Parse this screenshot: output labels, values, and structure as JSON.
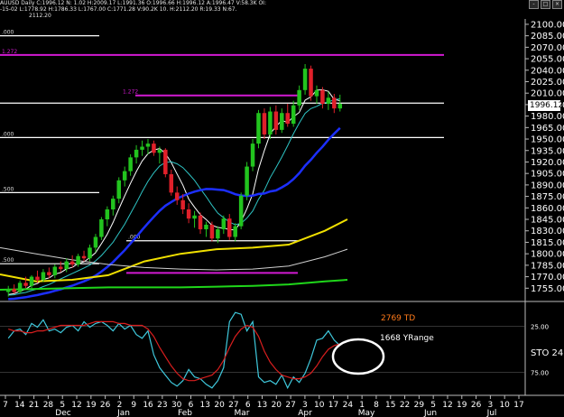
{
  "header": {
    "line1": "AUUSD Daily C:1996.12 N: 1.02 H:2009.17 L:1991.36 O:1996.66 H:1996.12 A:1996.47 V:58.3K OI:",
    "line2": "-15-02 L:1778.92 H:1786.33 L:1767.00 C:1771.28 V:90.2K 10. H:2112.20 R:19.33 N:67.",
    "line3": "2112.20",
    "window_buttons": [
      "-",
      "□",
      "×"
    ]
  },
  "colors": {
    "background": "#000000",
    "candle_up": "#22c41e",
    "candle_down": "#e0202a",
    "ma_fast": "#ffffff",
    "ma_mid": "#2ec4c4",
    "ma_blue": "#1c2fff",
    "ma_yellow": "#f0e000",
    "ma_green": "#1fd61a",
    "ma_white_slow": "#cfcfcf",
    "fib_magenta": "#d21ad2",
    "stoch_fast": "#3fc8dc",
    "stoch_slow": "#d81e1e",
    "annotation_orange": "#ff7a1a"
  },
  "chart_data": [
    {
      "type": "candlestick",
      "title": "AU/USD Daily",
      "ylim": [
        1740,
        2107
      ],
      "y_ticks": [
        "2100.00",
        "2085.00",
        "2070.00",
        "2055.00",
        "2040.00",
        "2025.00",
        "2010.00",
        "1995.00",
        "1980.00",
        "1965.00",
        "1950.00",
        "1935.00",
        "1920.00",
        "1905.00",
        "1890.00",
        "1875.00",
        "1860.00",
        "1845.00",
        "1830.00",
        "1815.00",
        "1800.00",
        "1785.00",
        "1770.00",
        "1755.00"
      ],
      "last_price_label": "1996.12",
      "x_tick_labels": [
        "7",
        "14",
        "21",
        "28",
        "5",
        "12",
        "19",
        "26",
        "2",
        "9",
        "16",
        "23",
        "30",
        "6",
        "13",
        "20",
        "27",
        "6",
        "13",
        "20",
        "27",
        "3",
        "10",
        "17",
        "24",
        "1",
        "8",
        "15",
        "22",
        "29",
        "5",
        "12",
        "19",
        "26",
        "3",
        "10",
        "17"
      ],
      "month_labels": [
        "Dec",
        "Jan",
        "Feb",
        "Mar",
        "Apr",
        "May",
        "Jun",
        "Jul"
      ],
      "horizontal_levels": [
        {
          "label": "1.272",
          "price": 2060,
          "color": "magenta",
          "span": "full"
        },
        {
          "label": "1.272",
          "price": 2007,
          "color": "magenta",
          "span": "right"
        },
        {
          "label": "",
          "price": 1997,
          "color": "white",
          "span": "full"
        },
        {
          "label": ".000",
          "price": 1952,
          "color": "white",
          "span": "full"
        },
        {
          "label": ".500",
          "price": 1880,
          "color": "white",
          "span": "left"
        },
        {
          "label": ".500",
          "price": 1787,
          "color": "white",
          "span": "left"
        },
        {
          "label": ".000",
          "price": 1817,
          "color": "white",
          "span": "mid"
        },
        {
          "label": ".000",
          "price": 2085,
          "color": "white",
          "span": "left"
        }
      ],
      "ohlc": [
        [
          1750,
          1758,
          1744,
          1754
        ],
        [
          1754,
          1760,
          1748,
          1750
        ],
        [
          1750,
          1765,
          1748,
          1762
        ],
        [
          1762,
          1770,
          1755,
          1758
        ],
        [
          1758,
          1772,
          1755,
          1770
        ],
        [
          1770,
          1778,
          1762,
          1766
        ],
        [
          1766,
          1780,
          1763,
          1776
        ],
        [
          1776,
          1782,
          1768,
          1772
        ],
        [
          1772,
          1786,
          1768,
          1783
        ],
        [
          1783,
          1790,
          1776,
          1780
        ],
        [
          1780,
          1794,
          1776,
          1790
        ],
        [
          1790,
          1798,
          1782,
          1786
        ],
        [
          1786,
          1800,
          1783,
          1797
        ],
        [
          1797,
          1804,
          1790,
          1794
        ],
        [
          1794,
          1812,
          1790,
          1808
        ],
        [
          1808,
          1826,
          1802,
          1822
        ],
        [
          1822,
          1848,
          1818,
          1845
        ],
        [
          1845,
          1862,
          1836,
          1858
        ],
        [
          1858,
          1876,
          1850,
          1872
        ],
        [
          1872,
          1900,
          1866,
          1896
        ],
        [
          1896,
          1914,
          1888,
          1908
        ],
        [
          1908,
          1930,
          1902,
          1926
        ],
        [
          1926,
          1942,
          1918,
          1936
        ],
        [
          1936,
          1948,
          1928,
          1940
        ],
        [
          1940,
          1950,
          1930,
          1944
        ],
        [
          1944,
          1948,
          1928,
          1932
        ],
        [
          1932,
          1940,
          1918,
          1936
        ],
        [
          1936,
          1938,
          1900,
          1904
        ],
        [
          1904,
          1910,
          1876,
          1880
        ],
        [
          1880,
          1888,
          1864,
          1870
        ],
        [
          1870,
          1878,
          1852,
          1858
        ],
        [
          1858,
          1866,
          1840,
          1846
        ],
        [
          1846,
          1856,
          1834,
          1850
        ],
        [
          1850,
          1854,
          1826,
          1832
        ],
        [
          1832,
          1842,
          1822,
          1838
        ],
        [
          1838,
          1842,
          1816,
          1820
        ],
        [
          1820,
          1836,
          1814,
          1832
        ],
        [
          1832,
          1850,
          1826,
          1846
        ],
        [
          1846,
          1852,
          1818,
          1822
        ],
        [
          1822,
          1840,
          1816,
          1836
        ],
        [
          1836,
          1880,
          1832,
          1876
        ],
        [
          1876,
          1920,
          1870,
          1914
        ],
        [
          1914,
          1950,
          1908,
          1944
        ],
        [
          1944,
          1988,
          1938,
          1984
        ],
        [
          1984,
          1990,
          1950,
          1956
        ],
        [
          1956,
          1992,
          1950,
          1986
        ],
        [
          1986,
          1994,
          1956,
          1962
        ],
        [
          1962,
          1990,
          1958,
          1984
        ],
        [
          1984,
          1996,
          1966,
          1970
        ],
        [
          1970,
          2000,
          1966,
          1994
        ],
        [
          1994,
          2020,
          1988,
          2014
        ],
        [
          2014,
          2048,
          2008,
          2042
        ],
        [
          2042,
          2046,
          2000,
          2006
        ],
        [
          2006,
          2020,
          1996,
          2014
        ],
        [
          2014,
          2018,
          1990,
          1996
        ],
        [
          1996,
          2012,
          1988,
          2004
        ],
        [
          2004,
          2009,
          1984,
          1990
        ],
        [
          1990,
          2008,
          1986,
          1996
        ]
      ]
    },
    {
      "type": "line",
      "title": "Stochastic",
      "ylim": [
        0,
        100
      ],
      "y_ticks": [
        "25.00",
        "75.00"
      ],
      "label": "STO 24.",
      "annotations": [
        "2769 TD",
        "1668 YRange"
      ],
      "series": [
        {
          "name": "%K",
          "values": [
            38,
            30,
            28,
            34,
            22,
            26,
            18,
            30,
            28,
            32,
            26,
            24,
            30,
            20,
            26,
            22,
            20,
            24,
            30,
            22,
            28,
            24,
            34,
            38,
            30,
            56,
            70,
            78,
            86,
            90,
            84,
            72,
            80,
            82,
            88,
            92,
            84,
            70,
            20,
            10,
            12,
            30,
            20,
            80,
            86,
            84,
            88,
            78,
            92,
            80,
            86,
            76,
            60,
            40,
            38,
            30,
            40,
            46
          ]
        },
        {
          "name": "%D",
          "values": [
            28,
            30,
            30,
            32,
            32,
            30,
            30,
            28,
            26,
            24,
            24,
            24,
            24,
            24,
            22,
            20,
            20,
            20,
            20,
            22,
            22,
            24,
            24,
            24,
            28,
            36,
            48,
            58,
            68,
            76,
            82,
            84,
            84,
            82,
            80,
            78,
            72,
            62,
            48,
            36,
            28,
            24,
            26,
            36,
            52,
            64,
            72,
            78,
            80,
            82,
            82,
            80,
            76,
            68,
            58,
            50,
            46,
            44
          ]
        }
      ]
    }
  ]
}
